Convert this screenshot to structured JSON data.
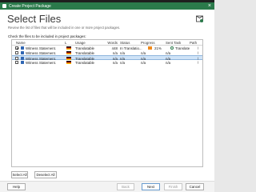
{
  "window": {
    "title": "Create Project Package"
  },
  "page": {
    "heading": "Select Files",
    "subheading": "Review the list of files that will be included in one or more project packages.",
    "instruction": "Check the files to be included in project packages:"
  },
  "columns": {
    "name": "Name",
    "lang": "L",
    "usage": "Usage",
    "words": "Words",
    "status": "Status",
    "progress": "Progress",
    "sent": "Sent Task",
    "path": "Path"
  },
  "rows": [
    {
      "checked": true,
      "name": "Witness Statement.d...",
      "usage": "Translatable",
      "words": "448",
      "status": "In Translatio...",
      "progress": "21%",
      "sent": "Translate",
      "path": "\\"
    },
    {
      "checked": false,
      "name": "Witness Statement.d...",
      "usage": "Translatable",
      "words": "n/a",
      "status": "n/a",
      "progress": "n/a",
      "sent": "n/a",
      "path": "\\"
    },
    {
      "checked": false,
      "name": "Witness Statement.d...",
      "usage": "Translatable",
      "words": "n/a",
      "status": "n/a",
      "progress": "n/a",
      "sent": "n/a",
      "path": "\\"
    },
    {
      "checked": false,
      "name": "Witness Statement.d...",
      "usage": "Translatable",
      "words": "n/a",
      "status": "n/a",
      "progress": "n/a",
      "sent": "n/a",
      "path": "\\"
    }
  ],
  "buttons": {
    "select_all": "Select All",
    "deselect_all": "Deselect All",
    "help": "Help",
    "back": "Back",
    "next": "Next",
    "finish": "Finish",
    "cancel": "Cancel"
  },
  "colors": {
    "titlebar": "#2b7a4b",
    "selection": "#cfe3f7",
    "progress": "#f08a1c"
  }
}
